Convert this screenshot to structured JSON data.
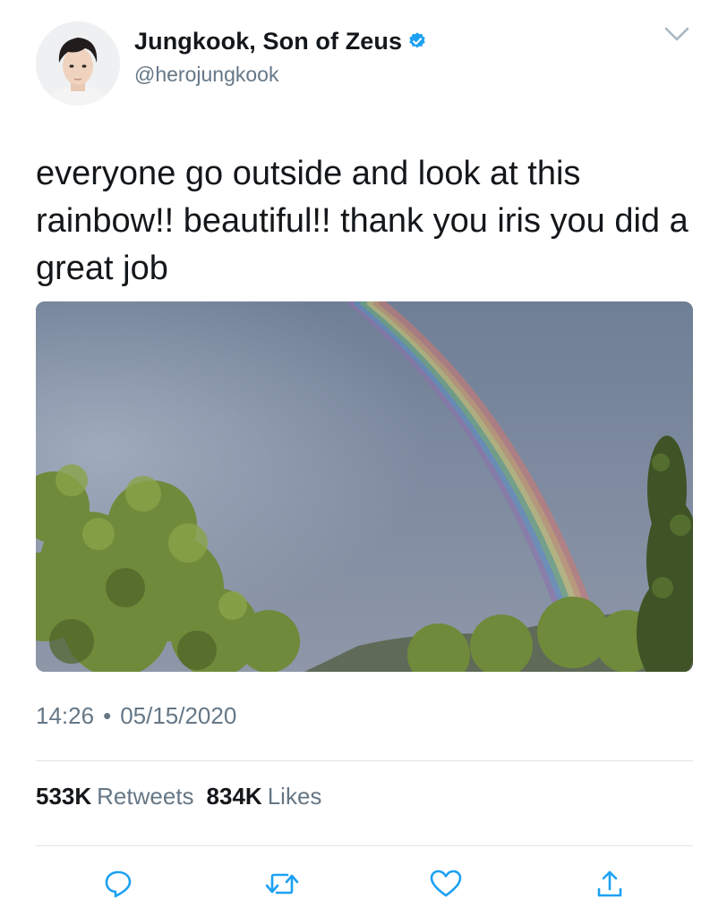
{
  "user": {
    "display_name": "Jungkook, Son of Zeus",
    "handle": "@herojungkook",
    "verified": true
  },
  "tweet": {
    "text": "everyone go outside and look at this rainbow!! beautiful!! thank you iris you did a great job",
    "time": "14:26",
    "separator": "•",
    "date": "05/15/2020"
  },
  "stats": {
    "retweets_count": "533K",
    "retweets_label": "Retweets",
    "likes_count": "834K",
    "likes_label": "Likes"
  },
  "icons": {
    "reply": "reply-icon",
    "retweet": "retweet-icon",
    "like": "like-icon",
    "share": "share-icon",
    "menu": "chevron-down-icon",
    "verified": "verified-badge-icon"
  },
  "colors": {
    "text_primary": "#14171a",
    "text_secondary": "#657786",
    "verified_blue": "#1da1f2",
    "action_icon": "#1da1f2"
  }
}
